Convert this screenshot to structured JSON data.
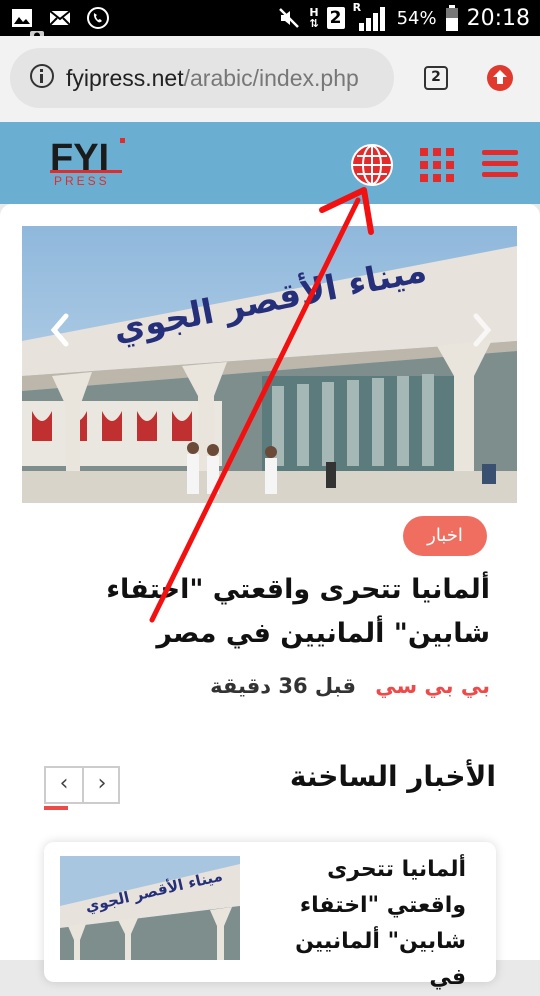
{
  "status_bar": {
    "network_letter": "H",
    "sim_number": "2",
    "roaming_letter": "R",
    "battery_percent": "54%",
    "time": "20:18",
    "icons": [
      "image-icon",
      "mail-icon",
      "phone-call-icon",
      "mute-icon",
      "signal-icon",
      "battery-icon"
    ]
  },
  "browser": {
    "url_domain": "fyipress.net",
    "url_path": "/arabic/index.php",
    "tab_count": "2"
  },
  "site": {
    "logo_text": "FYI",
    "logo_subtext": "PRESS",
    "accent_color": "#e32b2b",
    "header_color": "#6aafd2"
  },
  "featured": {
    "image_sign_text": "ميناء الأقصر الجوي",
    "category": "اخبار",
    "headline": "ألمانيا تتحرى واقعتي \"اختفاء شابين\" ألمانيين في مصر",
    "source": "بي بي سي",
    "time_ago": "قبل 36 دقيقة"
  },
  "trending": {
    "title": "الأخبار الساخنة",
    "prev_label": "‹",
    "next_label": "›",
    "items": [
      {
        "title": "ألمانيا تتحرى واقعتي \"اختفاء شابين\" ألمانيين في"
      }
    ]
  }
}
